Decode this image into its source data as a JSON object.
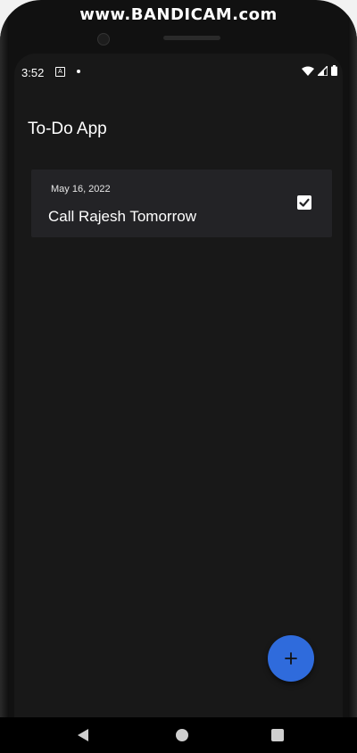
{
  "watermark": "www.BANDICAM.com",
  "status_bar": {
    "time": "3:52",
    "notification_icon": "a-icon",
    "wifi_icon": "wifi-icon",
    "signal_icon": "signal-icon",
    "battery_icon": "battery-icon"
  },
  "app": {
    "title": "To-Do App",
    "tasks": [
      {
        "date": "May 16, 2022",
        "title": "Call Rajesh Tomorrow",
        "completed": true
      }
    ],
    "fab_icon": "plus-icon",
    "accent_color": "#2f6bdc"
  },
  "nav_bar": {
    "back_icon": "back-icon",
    "home_icon": "home-icon",
    "recents_icon": "recents-icon"
  }
}
